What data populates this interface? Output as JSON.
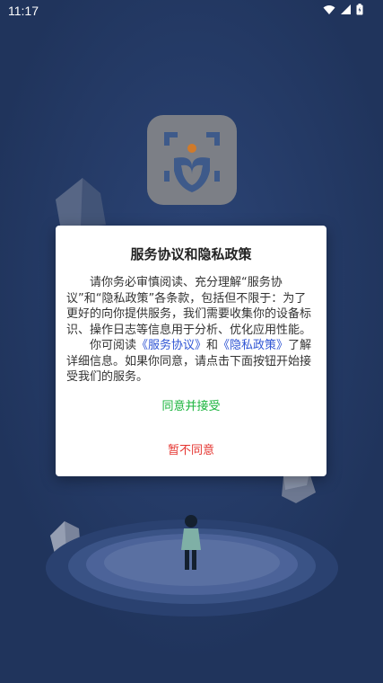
{
  "status_bar": {
    "time": "11:17"
  },
  "dialog": {
    "title": "服务协议和隐私政策",
    "paragraph1": "请你务必审慎阅读、充分理解“服务协议”和“隐私政策”各条款，包括但不限于：为了更好的向你提供服务，我们需要收集你的设备标识、操作日志等信息用于分析、优化应用性能。",
    "p2_prefix": "你可阅读",
    "service_link": "《服务协议》",
    "p2_and": "和",
    "privacy_link": "《隐私政策》",
    "p2_suffix": "了解详细信息。如果你同意，请点击下面按钮开始接受我们的服务。",
    "accept_label": "同意并接受",
    "decline_label": "暂不同意"
  },
  "colors": {
    "background": "#21365f",
    "accept": "#17b33a",
    "decline": "#e53530",
    "link": "#2f55d4"
  },
  "icons": [
    "wifi-icon",
    "signal-icon",
    "battery-icon",
    "app-logo-icon"
  ]
}
